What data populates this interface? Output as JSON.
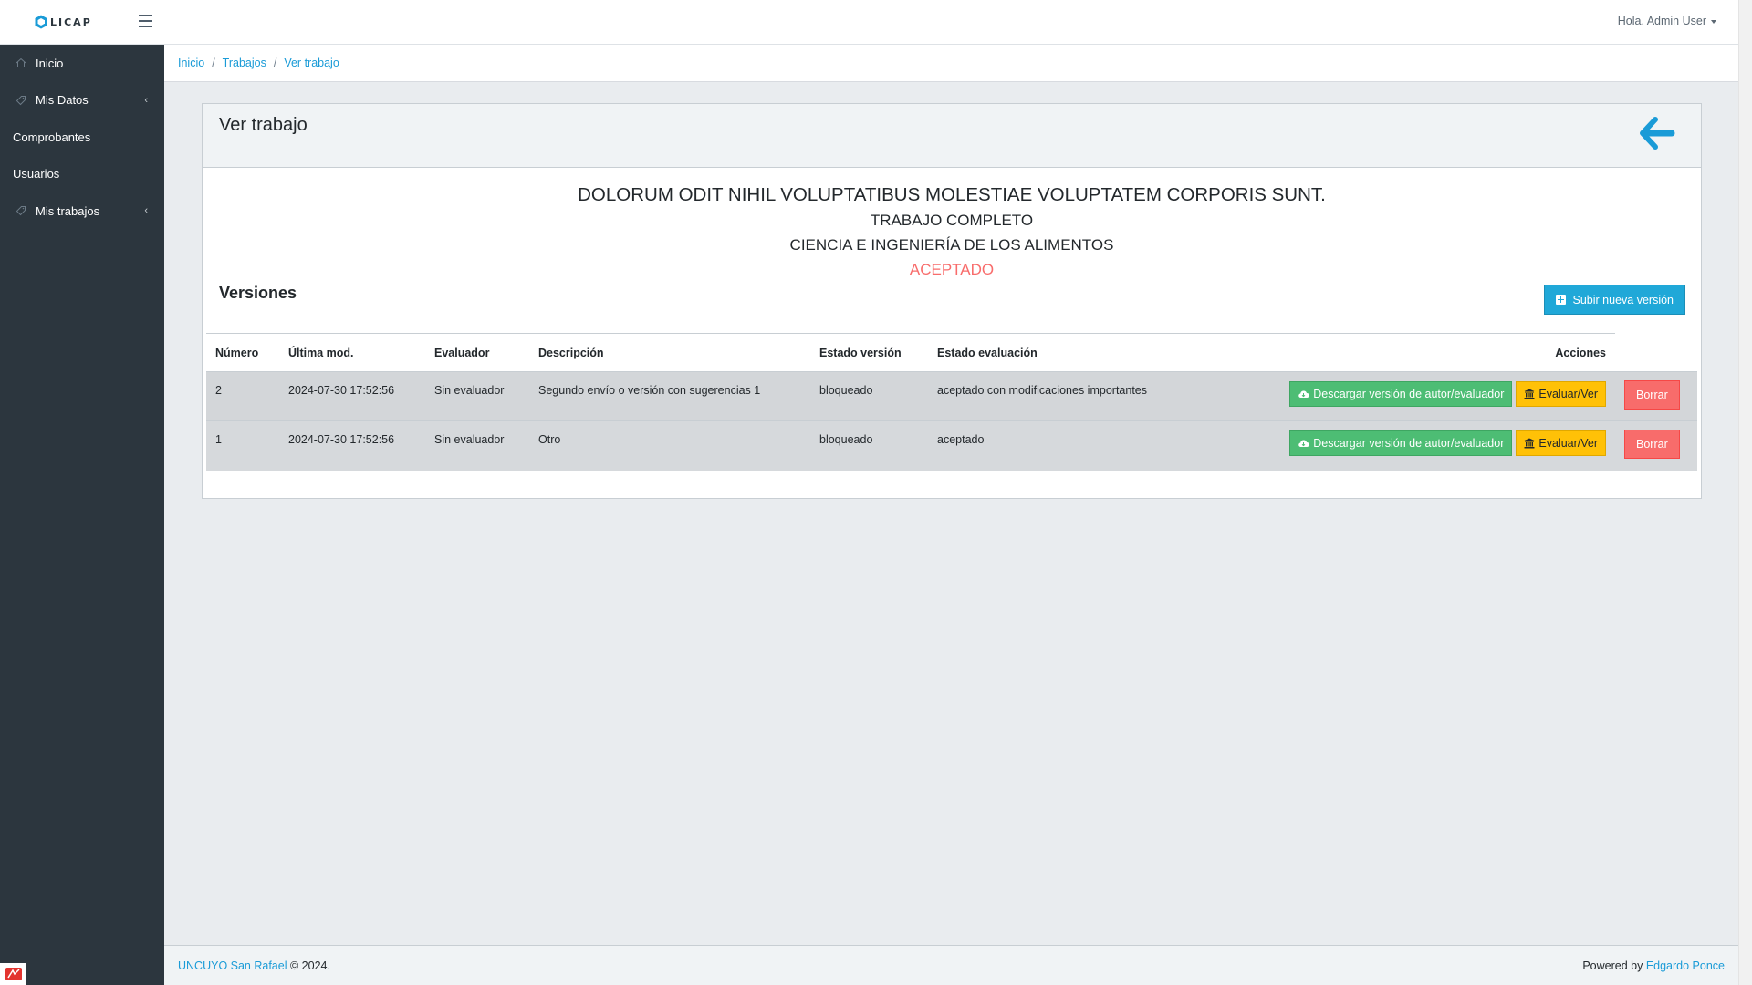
{
  "brand": {
    "name": "LICAP"
  },
  "header": {
    "user_greeting": "Hola, Admin User"
  },
  "sidebar": {
    "items": [
      {
        "label": "Inicio",
        "icon": "home-icon"
      },
      {
        "label": "Mis Datos",
        "icon": "tag-icon"
      },
      {
        "label": "Comprobantes"
      },
      {
        "label": "Usuarios"
      },
      {
        "label": "Mis trabajos",
        "icon": "tag-icon"
      }
    ]
  },
  "breadcrumb": {
    "items": [
      "Inicio",
      "Trabajos",
      "Ver trabajo"
    ]
  },
  "card": {
    "title": "Ver trabajo",
    "work_title": "DOLORUM ODIT NIHIL VOLUPTATIBUS MOLESTIAE VOLUPTATEM CORPORIS SUNT.",
    "work_type": "TRABAJO COMPLETO",
    "area": "CIENCIA E INGENIERÍA DE LOS ALIMENTOS",
    "status": "ACEPTADO",
    "status_color": "#f86c6b"
  },
  "versions": {
    "title": "Versiones",
    "new_button": "Subir nueva versión",
    "headers": [
      "Número",
      "Última mod.",
      "Evaluador",
      "Descripción",
      "Estado versión",
      "Estado evaluación",
      "Acciones"
    ],
    "rows": [
      {
        "numero": "2",
        "ultima_mod": "2024-07-30 17:52:56",
        "evaluador": "Sin evaluador",
        "descripcion": "Segundo envío o versión con sugerencias 1",
        "estado_version": "bloqueado",
        "estado_evaluacion": "aceptado con modificaciones importantes"
      },
      {
        "numero": "1",
        "ultima_mod": "2024-07-30 17:52:56",
        "evaluador": "Sin evaluador",
        "descripcion": "Otro",
        "estado_version": "bloqueado",
        "estado_evaluacion": "aceptado"
      }
    ],
    "actions": {
      "download": "Descargar versión de autor/evaluador",
      "evaluate": "Evaluar/Ver",
      "delete": "Borrar"
    }
  },
  "footer": {
    "org_link": "UNCUYO San Rafael",
    "copyright": "© 2024.",
    "powered_by": "Powered by",
    "author_link": "Edgardo Ponce"
  },
  "colors": {
    "sidebar_bg": "#2c363e",
    "accent": "#20a8d8",
    "success": "#4dbd74",
    "warning": "#ffc107",
    "danger": "#f86c6b"
  }
}
